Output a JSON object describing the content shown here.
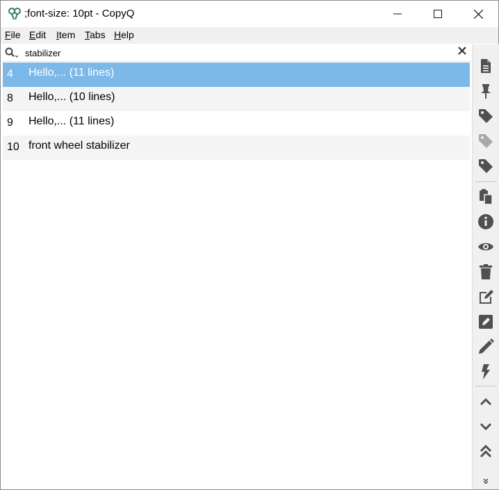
{
  "window": {
    "title": ";font-size: 10pt - CopyQ"
  },
  "menu": [
    {
      "name": "menu-file",
      "key": "F",
      "rest": "ile"
    },
    {
      "name": "menu-edit",
      "key": "E",
      "rest": "dit"
    },
    {
      "name": "menu-item",
      "key": "I",
      "rest": "tem"
    },
    {
      "name": "menu-tabs",
      "key": "T",
      "rest": "abs"
    },
    {
      "name": "menu-help",
      "key": "H",
      "rest": "elp"
    }
  ],
  "search": {
    "value": "stabilizer"
  },
  "items": [
    {
      "num": "4",
      "text": "Hello,... (11 lines)",
      "selected": true
    },
    {
      "num": "8",
      "text": "Hello,... (10 lines)",
      "selected": false
    },
    {
      "num": "9",
      "text": "Hello,... (11 lines)",
      "selected": false
    },
    {
      "num": "10",
      "text": "front wheel stabilizer",
      "selected": false
    }
  ],
  "toolbar_icons": [
    "document-icon",
    "pin-icon",
    "tag-icon",
    "tag-light-icon",
    "tag-icon",
    "paste-icon",
    "info-icon",
    "eye-icon",
    "trash-icon",
    "edit-external-icon",
    "edit-icon",
    "pencil-icon",
    "lightning-icon",
    "chevron-up-icon",
    "chevron-down-icon",
    "double-chevron-up-icon",
    "overflow-chevron-icon"
  ],
  "colors": {
    "selection": "#7db9e8",
    "icon": "#505050",
    "toolbar_bg": "#f0f0f0"
  }
}
